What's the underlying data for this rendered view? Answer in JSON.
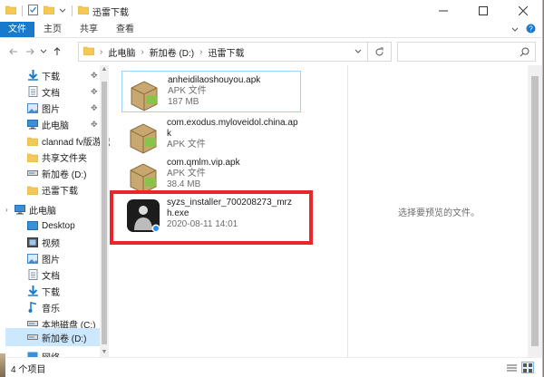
{
  "window": {
    "title": "迅雷下载"
  },
  "ribbon": {
    "tabs": [
      "文件",
      "主页",
      "共享",
      "查看"
    ]
  },
  "address": {
    "crumbs": [
      "此电脑",
      "新加卷 (D:)",
      "迅雷下载"
    ]
  },
  "nav": {
    "quick_access": [
      {
        "label": "下载",
        "icon": "download-arrow-icon",
        "pinned": true
      },
      {
        "label": "文档",
        "icon": "document-icon",
        "pinned": true
      },
      {
        "label": "图片",
        "icon": "picture-icon",
        "pinned": true
      },
      {
        "label": "此电脑",
        "icon": "computer-icon",
        "pinned": true
      },
      {
        "label": "clannad fv版游戏",
        "icon": "folder-icon",
        "pinned": false
      },
      {
        "label": "共享文件夹",
        "icon": "folder-icon",
        "pinned": false
      },
      {
        "label": "新加卷 (D:)",
        "icon": "drive-icon",
        "pinned": false
      },
      {
        "label": "迅雷下载",
        "icon": "folder-icon",
        "pinned": false
      }
    ],
    "this_pc": {
      "label": "此电脑",
      "children": [
        {
          "label": "Desktop",
          "icon": "desktop-icon"
        },
        {
          "label": "视频",
          "icon": "video-icon"
        },
        {
          "label": "图片",
          "icon": "picture-icon"
        },
        {
          "label": "文档",
          "icon": "document-icon"
        },
        {
          "label": "下载",
          "icon": "download-arrow-icon"
        },
        {
          "label": "音乐",
          "icon": "music-icon"
        },
        {
          "label": "本地磁盘 (C:)",
          "icon": "drive-icon"
        },
        {
          "label": "新加卷 (D:)",
          "icon": "drive-icon",
          "selected": true
        }
      ]
    },
    "network": {
      "label": "网络"
    }
  },
  "files": [
    {
      "name": "anheidilaoshouyou.apk",
      "type": "APK 文件",
      "size": "187 MB"
    },
    {
      "name": "com.exodus.myloveidol.china.apk",
      "type": "APK 文件",
      "size": ""
    },
    {
      "name": "com.qmlm.vip.apk",
      "type": "APK 文件",
      "size": "38.4 MB"
    },
    {
      "name": "syzs_installer_700208273_mrzh.exe",
      "date": "2020-08-11 14:01"
    }
  ],
  "preview": {
    "message": "选择要预览的文件。"
  },
  "status": {
    "item_count": "4 个项目"
  },
  "colors": {
    "accent": "#1979ca",
    "highlight": "#e8262b",
    "selected_bg": "#cce8ff"
  }
}
